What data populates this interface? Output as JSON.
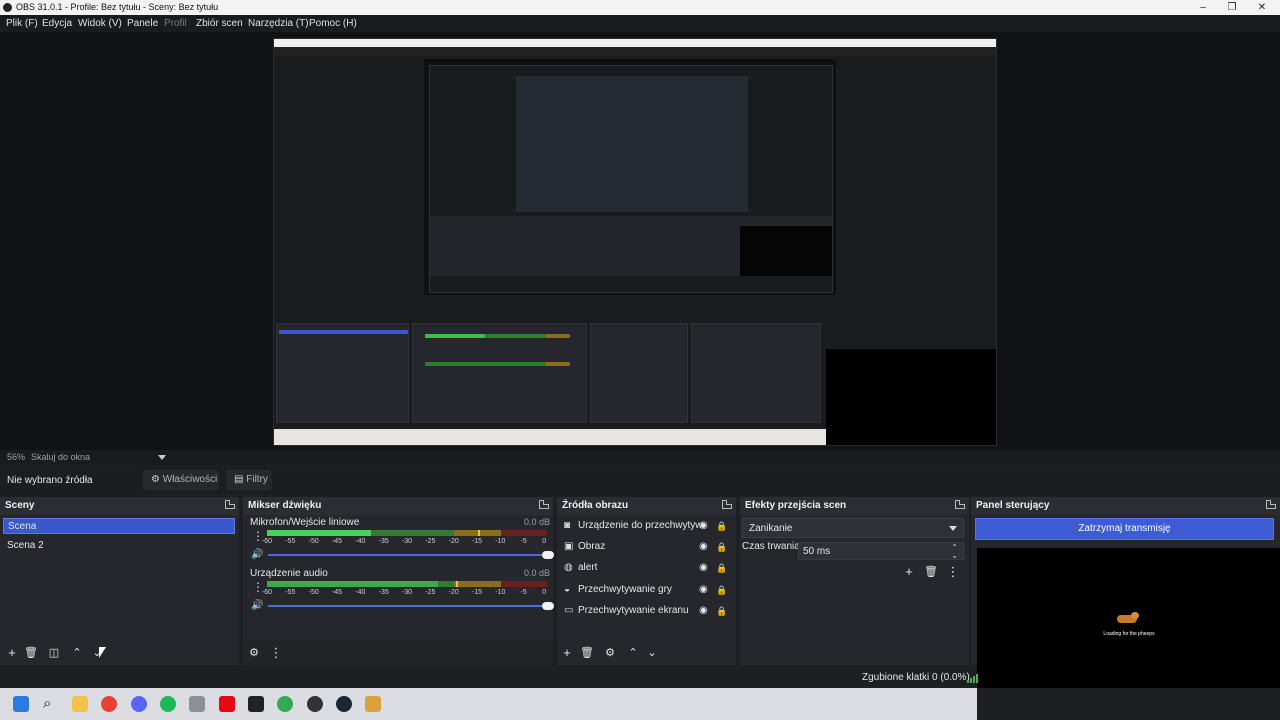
{
  "window": {
    "title": "OBS 31.0.1 - Profile: Bez tytułu - Sceny: Bez tytułu",
    "minimize": "–",
    "maximize": "❐",
    "close": "✕"
  },
  "menu": {
    "items": [
      "Plik (F)",
      "Edycja",
      "Widok (V)",
      "Panele",
      "Profil",
      "Zbiór scen",
      "Narzędzia (T)",
      "Pomoc (H)"
    ]
  },
  "preview": {
    "zoom": "56%",
    "scale_mode": "Skaluj do okna"
  },
  "source_toolbar": {
    "no_source": "Nie wybrano źródła",
    "properties": "Właściwości",
    "filters": "Filtry"
  },
  "scenes": {
    "title": "Sceny",
    "items": [
      "Scena",
      "Scena 2"
    ],
    "selected_index": 0
  },
  "mixer": {
    "title": "Mikser dźwięku",
    "channels": [
      {
        "name": "Mikrofon/Wejście liniowe",
        "db": "0.0 dB",
        "level": 0.37,
        "peak": 0.755
      },
      {
        "name": "Urządzenie audio",
        "db": "0.0 dB",
        "level": 0.61,
        "peak": 0.675
      }
    ],
    "ticks": [
      "-60",
      "-55",
      "-50",
      "-45",
      "-40",
      "-35",
      "-30",
      "-25",
      "-20",
      "-15",
      "-10",
      "-5",
      "0"
    ]
  },
  "sources": {
    "title": "Źródła obrazu",
    "items": [
      {
        "name": "Urządzenie do przechwytywania wideo",
        "icon": "camera-icon"
      },
      {
        "name": "Obraz",
        "icon": "image-icon"
      },
      {
        "name": "alert",
        "icon": "browser-icon"
      },
      {
        "name": "Przechwytywanie gry",
        "icon": "gamepad-icon"
      },
      {
        "name": "Przechwytywanie ekranu",
        "icon": "monitor-icon"
      }
    ]
  },
  "transitions": {
    "title": "Efekty przejścia scen",
    "selected": "Zanikanie",
    "duration_label": "Czas trwania",
    "duration": "50 ms"
  },
  "controls": {
    "title": "Panel sterujący",
    "stream_button": "Zatrzymaj transmisję",
    "loading_text": "Loading for the pheeps"
  },
  "status": {
    "dropped_frames": "Zgubione klatki 0 (0.0%)"
  },
  "colors": {
    "accent": "#3e5bd6",
    "meter_green": "#4caf50",
    "meter_yellow": "#c9a227",
    "meter_red": "#c0392b"
  }
}
